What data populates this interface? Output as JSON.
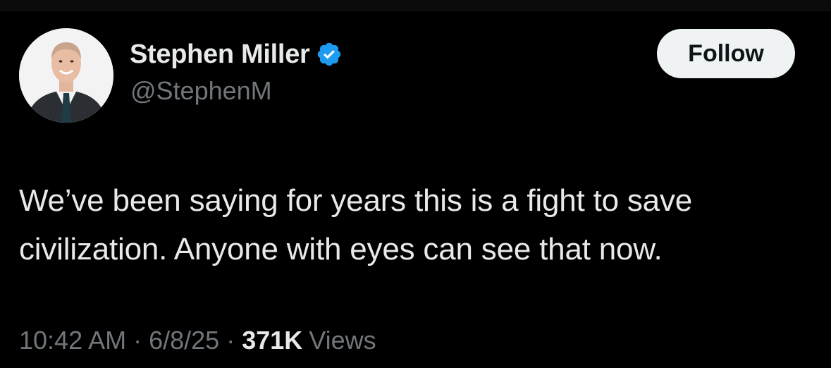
{
  "author": {
    "display_name": "Stephen Miller",
    "handle": "@StephenM",
    "verified": true,
    "verified_badge_color": "#1d9bf0"
  },
  "actions": {
    "follow_label": "Follow"
  },
  "tweet": {
    "text_lines": [
      "We’ve been saying for years this is a fight to save",
      "civilization. Anyone with eyes can see that now."
    ]
  },
  "meta": {
    "time": "10:42 AM",
    "date": "6/8/25",
    "separator": "·",
    "views_count": "371K",
    "views_label": "Views"
  },
  "colors": {
    "background": "#000000",
    "primary_text": "#e7e9ea",
    "secondary_text": "#71767b",
    "follow_button_bg": "#eff3f4",
    "follow_button_text": "#0f1419"
  }
}
